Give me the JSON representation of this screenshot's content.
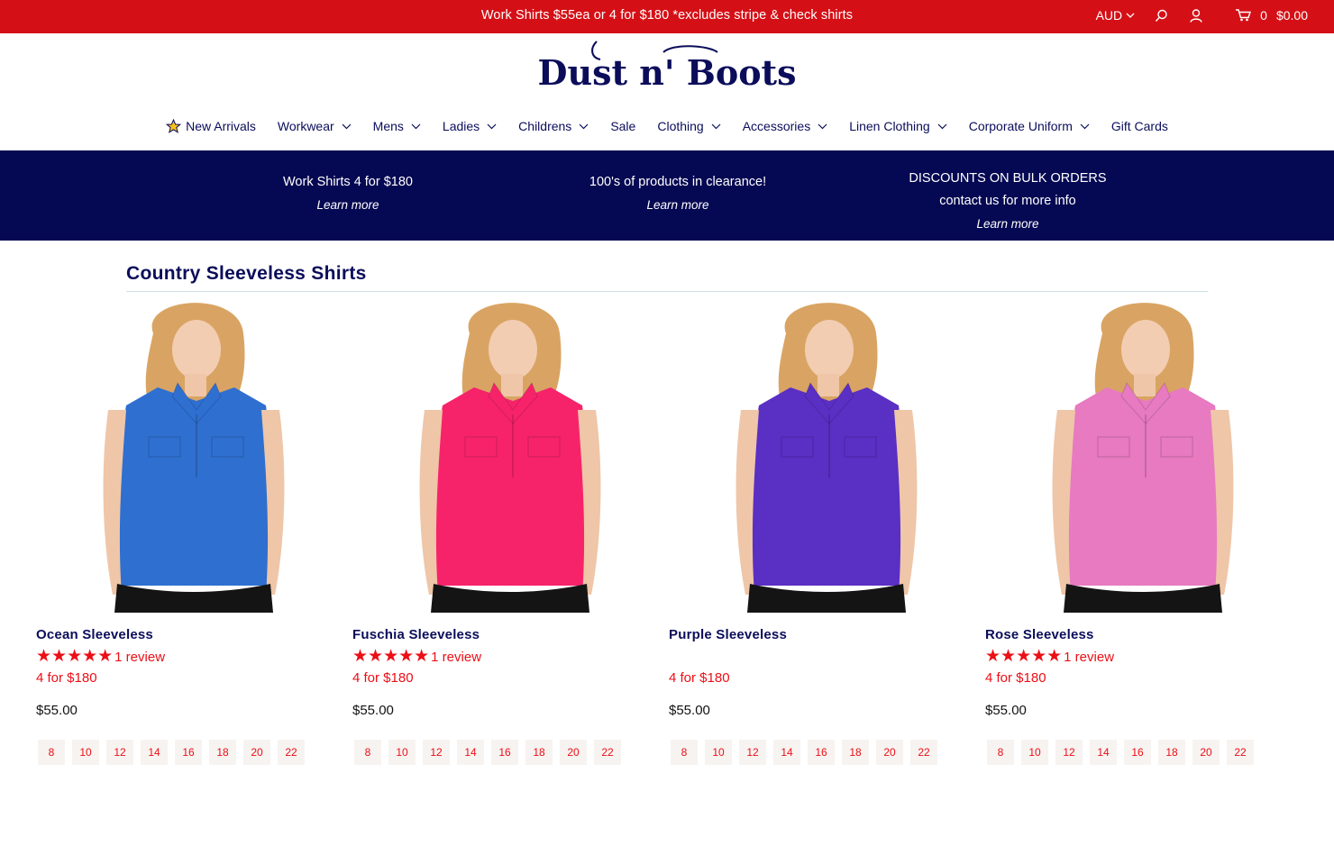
{
  "announcement": {
    "text": "Work Shirts $55ea or 4 for $180 *excludes stripe & check shirts",
    "currency": "AUD",
    "cart_count": "0",
    "cart_total": "$0.00",
    "icons": [
      "chevron-down-icon",
      "search-icon",
      "account-icon",
      "cart-icon"
    ],
    "background": "#d41016"
  },
  "logo": {
    "text": "Dust n' Boots"
  },
  "nav": [
    {
      "label": "New Arrivals",
      "has_dropdown": false,
      "icon": "star-icon"
    },
    {
      "label": "Workwear",
      "has_dropdown": true
    },
    {
      "label": "Mens",
      "has_dropdown": true
    },
    {
      "label": "Ladies",
      "has_dropdown": true
    },
    {
      "label": "Childrens",
      "has_dropdown": true
    },
    {
      "label": "Sale",
      "has_dropdown": false
    },
    {
      "label": "Clothing",
      "has_dropdown": true
    },
    {
      "label": "Accessories",
      "has_dropdown": true
    },
    {
      "label": "Linen Clothing",
      "has_dropdown": true
    },
    {
      "label": "Corporate Uniform",
      "has_dropdown": true
    },
    {
      "label": "Gift Cards",
      "has_dropdown": false
    }
  ],
  "promo_band": {
    "background": "#050852",
    "items": [
      {
        "lines": [
          "Work Shirts 4 for $180"
        ],
        "link": "Learn more"
      },
      {
        "lines": [
          "100's of products in clearance!"
        ],
        "link": "Learn more"
      },
      {
        "lines": [
          "DISCOUNTS ON BULK ORDERS",
          "contact us for more info"
        ],
        "link": "Learn more"
      }
    ]
  },
  "collection": {
    "title": "Country Sleeveless Shirts",
    "products": [
      {
        "name": "Ocean Sleeveless",
        "stars": "★★★★★",
        "review": "1 review",
        "deal": "4 for $180",
        "price": "$55.00",
        "shirt_color": "#2f6fd0",
        "sizes": [
          "8",
          "10",
          "12",
          "14",
          "16",
          "18",
          "20",
          "22"
        ]
      },
      {
        "name": "Fuschia Sleeveless",
        "stars": "★★★★★",
        "review": "1 review",
        "deal": "4 for $180",
        "price": "$55.00",
        "shirt_color": "#f7236a",
        "sizes": [
          "8",
          "10",
          "12",
          "14",
          "16",
          "18",
          "20",
          "22"
        ]
      },
      {
        "name": "Purple Sleeveless",
        "stars": "",
        "review": "",
        "deal": "4 for $180",
        "price": "$55.00",
        "shirt_color": "#5a2fc4",
        "sizes": [
          "8",
          "10",
          "12",
          "14",
          "16",
          "18",
          "20",
          "22"
        ]
      },
      {
        "name": "Rose Sleeveless",
        "stars": "★★★★★",
        "review": "1 review",
        "deal": "4 for $180",
        "price": "$55.00",
        "shirt_color": "#e77ac0",
        "sizes": [
          "8",
          "10",
          "12",
          "14",
          "16",
          "18",
          "20",
          "22"
        ]
      }
    ]
  },
  "colors": {
    "navy": "#0b0d5a",
    "red": "#ec0f16"
  }
}
